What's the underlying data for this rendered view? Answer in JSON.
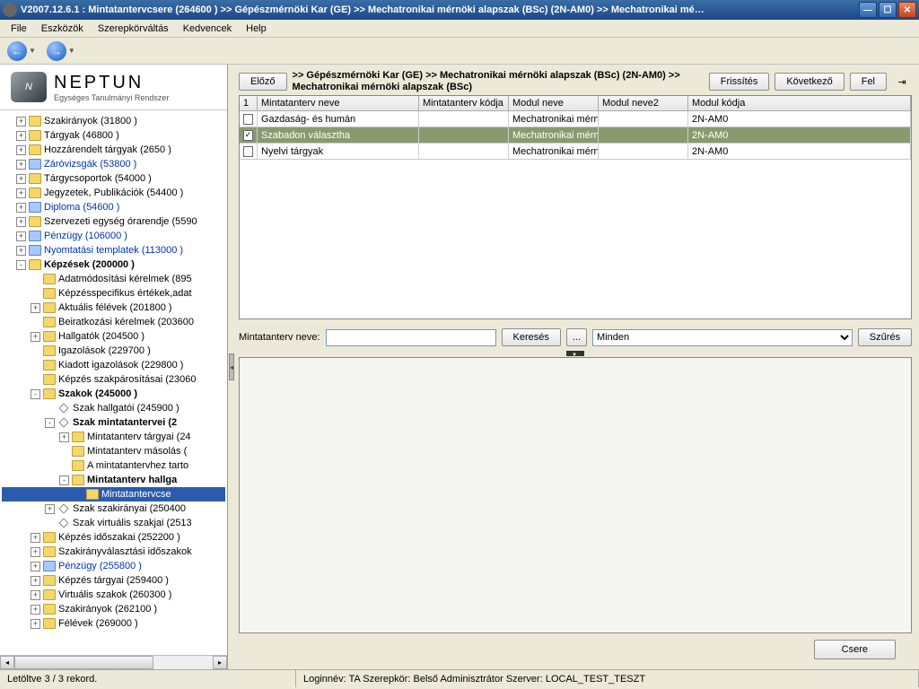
{
  "window": {
    "title": "V2007.12.6.1 : Mintatantervcsere (264600  )   >> Gépészmérnöki Kar (GE) >> Mechatronikai mérnöki alapszak (BSc) (2N-AM0) >> Mechatronikai mé…"
  },
  "menu": {
    "file": "File",
    "tools": "Eszközök",
    "role": "Szerepkörváltás",
    "fav": "Kedvencek",
    "help": "Help"
  },
  "logo": {
    "main": "NEPTUN",
    "sub": "Egységes Tanulmányi Rendszer",
    "mark": "N"
  },
  "tree": [
    {
      "ind": 1,
      "exp": "+",
      "lbl": "Szakirányok (31800  )"
    },
    {
      "ind": 1,
      "exp": "+",
      "lbl": "Tárgyak (46800  )"
    },
    {
      "ind": 1,
      "exp": "+",
      "lbl": "Hozzárendelt tárgyak (2650  )"
    },
    {
      "ind": 1,
      "exp": "+",
      "lbl": "Záróvizsgák (53800  )",
      "link": true
    },
    {
      "ind": 1,
      "exp": "+",
      "lbl": "Tárgycsoportok (54000  )"
    },
    {
      "ind": 1,
      "exp": "+",
      "lbl": "Jegyzetek, Publikációk (54400  )"
    },
    {
      "ind": 1,
      "exp": "+",
      "lbl": "Diploma (54600  )",
      "link": true
    },
    {
      "ind": 1,
      "exp": "+",
      "lbl": "Szervezeti egység órarendje (5590"
    },
    {
      "ind": 1,
      "exp": "+",
      "lbl": "Pénzügy (106000  )",
      "link": true
    },
    {
      "ind": 1,
      "exp": "+",
      "lbl": "Nyomtatási templatek (113000  )",
      "link": true
    },
    {
      "ind": 1,
      "exp": "-",
      "lbl": "Képzések (200000  )",
      "bold": true
    },
    {
      "ind": 2,
      "exp": " ",
      "lbl": "Adatmódosítási kérelmek (895"
    },
    {
      "ind": 2,
      "exp": " ",
      "lbl": "Képzésspecifikus értékek,adat"
    },
    {
      "ind": 2,
      "exp": "+",
      "lbl": "Aktuális félévek (201800  )"
    },
    {
      "ind": 2,
      "exp": " ",
      "lbl": "Beiratkozási kérelmek (203600"
    },
    {
      "ind": 2,
      "exp": "+",
      "lbl": "Hallgatók (204500  )"
    },
    {
      "ind": 2,
      "exp": " ",
      "lbl": "Igazolások (229700  )"
    },
    {
      "ind": 2,
      "exp": " ",
      "lbl": "Kiadott igazolások (229800  )"
    },
    {
      "ind": 2,
      "exp": " ",
      "lbl": "Képzés szakpárosításai (23060"
    },
    {
      "ind": 2,
      "exp": "-",
      "lbl": "Szakok (245000  )",
      "bold": true
    },
    {
      "ind": 3,
      "exp": " ",
      "lbl": "Szak hallgatói (245900  )",
      "dico": true
    },
    {
      "ind": 3,
      "exp": "-",
      "lbl": "Szak mintatantervei (2",
      "bold": true,
      "dico": true
    },
    {
      "ind": 4,
      "exp": "+",
      "lbl": "Mintatanterv tárgyai (24"
    },
    {
      "ind": 4,
      "exp": " ",
      "lbl": "Mintatanterv másolás ("
    },
    {
      "ind": 4,
      "exp": " ",
      "lbl": "A mintatantervhez tarto"
    },
    {
      "ind": 4,
      "exp": "-",
      "lbl": "Mintatanterv hallga",
      "bold": true
    },
    {
      "ind": 5,
      "exp": " ",
      "lbl": "Mintatantervcse",
      "sel": true
    },
    {
      "ind": 3,
      "exp": "+",
      "lbl": "Szak szakirányai (250400",
      "dico": true
    },
    {
      "ind": 3,
      "exp": " ",
      "lbl": "Szak virtuális szakjai (2513",
      "dico": true
    },
    {
      "ind": 2,
      "exp": "+",
      "lbl": "Képzés időszakai (252200  )"
    },
    {
      "ind": 2,
      "exp": "+",
      "lbl": "Szakirányválasztási időszakok"
    },
    {
      "ind": 2,
      "exp": "+",
      "lbl": "Pénzügy (255800  )",
      "link": true
    },
    {
      "ind": 2,
      "exp": "+",
      "lbl": "Képzés tárgyai (259400  )"
    },
    {
      "ind": 2,
      "exp": "+",
      "lbl": "Virtuális szakok (260300  )"
    },
    {
      "ind": 2,
      "exp": "+",
      "lbl": "Szakirányok (262100  )"
    },
    {
      "ind": 2,
      "exp": "+",
      "lbl": "Félévek (269000  )"
    }
  ],
  "topbar": {
    "prev": "Előző",
    "breadcrumb": ">> Gépészmérnöki Kar (GE) >> Mechatronikai mérnöki alapszak (BSc) (2N-AM0) >> Mechatronikai mérnöki alapszak (BSc)",
    "refresh": "Frissítés",
    "next": "Következő",
    "up": "Fel"
  },
  "grid": {
    "headers": {
      "h0": "1",
      "h1": "Mintatanterv neve",
      "h2": "Mintatanterv kódja",
      "h3": "Modul neve",
      "h4": "Modul neve2",
      "h5": "Modul kódja"
    },
    "rows": [
      {
        "chk": false,
        "c1": "Gazdaság- és humán",
        "c2": "",
        "c3": "Mechatronikai mérnö",
        "c4": "",
        "c5": "2N-AM0"
      },
      {
        "chk": true,
        "c1": "Szabadon választha",
        "c2": "",
        "c3": "Mechatronikai mérnö",
        "c4": "",
        "c5": "2N-AM0",
        "sel": true
      },
      {
        "chk": false,
        "c1": "Nyelvi tárgyak",
        "c2": "",
        "c3": "Mechatronikai mérnö",
        "c4": "",
        "c5": "2N-AM0"
      }
    ]
  },
  "filter": {
    "label": "Mintatanterv neve:",
    "search": "Keresés",
    "ellipsis": "...",
    "dropdown": "Minden",
    "apply": "Szűrés"
  },
  "action": {
    "swap": "Csere"
  },
  "status": {
    "records": "Letöltve 3 / 3 rekord.",
    "info": "Loginnév: TA   Szerepkör: Belső Adminisztrátor   Szerver: LOCAL_TEST_TESZT"
  }
}
